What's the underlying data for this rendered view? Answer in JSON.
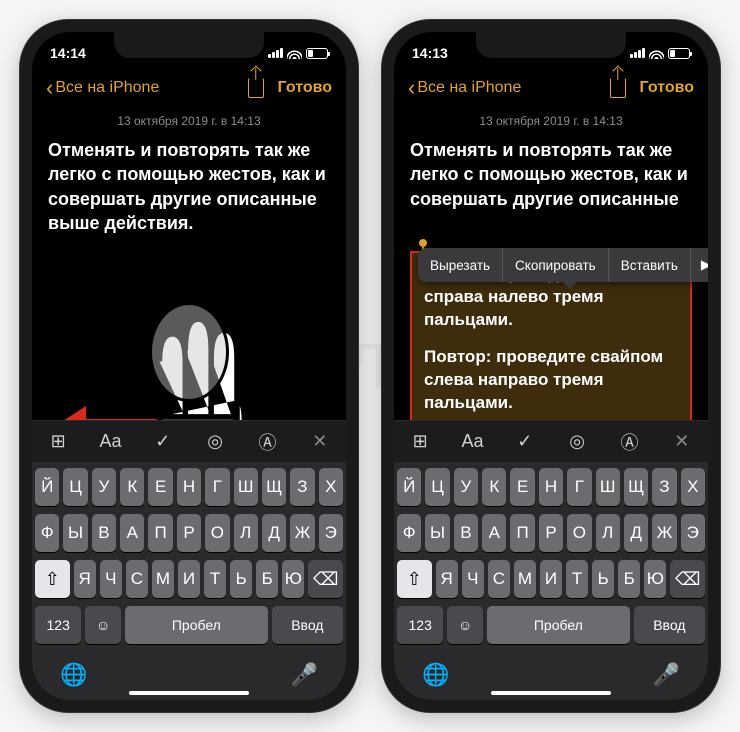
{
  "watermark": "ЯБЛЫК",
  "left": {
    "status_time": "14:14",
    "nav_back": "Все на iPhone",
    "nav_done": "Готово",
    "date": "13 октября 2019 г. в 14:13",
    "paragraph1": "Отменять и повторять так же легко с помощью жестов, как и совершать другие описанные выше действия.",
    "keyboard": {
      "row1": [
        "Й",
        "Ц",
        "У",
        "К",
        "Е",
        "Н",
        "Г",
        "Ш",
        "Щ",
        "З",
        "Х"
      ],
      "row2": [
        "Ф",
        "Ы",
        "В",
        "А",
        "П",
        "Р",
        "О",
        "Л",
        "Д",
        "Ж",
        "Э"
      ],
      "row3_letters": [
        "Я",
        "Ч",
        "С",
        "М",
        "И",
        "Т",
        "Ь",
        "Б",
        "Ю"
      ],
      "num_key": "123",
      "space": "Пробел",
      "enter": "Ввод"
    }
  },
  "right": {
    "status_time": "14:13",
    "nav_back": "Все на iPhone",
    "nav_done": "Готово",
    "date": "13 октября 2019 г. в 14:13",
    "paragraph1": "Отменять и повторять так же легко с помощью жестов, как и совершать другие описанные",
    "context_menu": [
      "Вырезать",
      "Скопировать",
      "Вставить",
      "▶"
    ],
    "selection_p1": "Отмена: проведите свайпом справа налево тремя пальцами.",
    "selection_p2": "Повтор: проведите свайпом слева направо тремя пальцами.",
    "keyboard": {
      "row1": [
        "Й",
        "Ц",
        "У",
        "К",
        "Е",
        "Н",
        "Г",
        "Ш",
        "Щ",
        "З",
        "Х"
      ],
      "row2": [
        "Ф",
        "Ы",
        "В",
        "А",
        "П",
        "Р",
        "О",
        "Л",
        "Д",
        "Ж",
        "Э"
      ],
      "row3_letters": [
        "Я",
        "Ч",
        "С",
        "М",
        "И",
        "Т",
        "Ь",
        "Б",
        "Ю"
      ],
      "num_key": "123",
      "space": "Пробел",
      "enter": "Ввод"
    }
  },
  "icons": {
    "shift": "⇧",
    "backspace": "⌫",
    "emoji": "☺",
    "globe": "🌐",
    "mic": "🎤",
    "table": "⊞",
    "aa": "Aa",
    "check": "✓",
    "camera": "◎",
    "marker": "Ⓐ",
    "close": "✕",
    "more": "▶"
  }
}
